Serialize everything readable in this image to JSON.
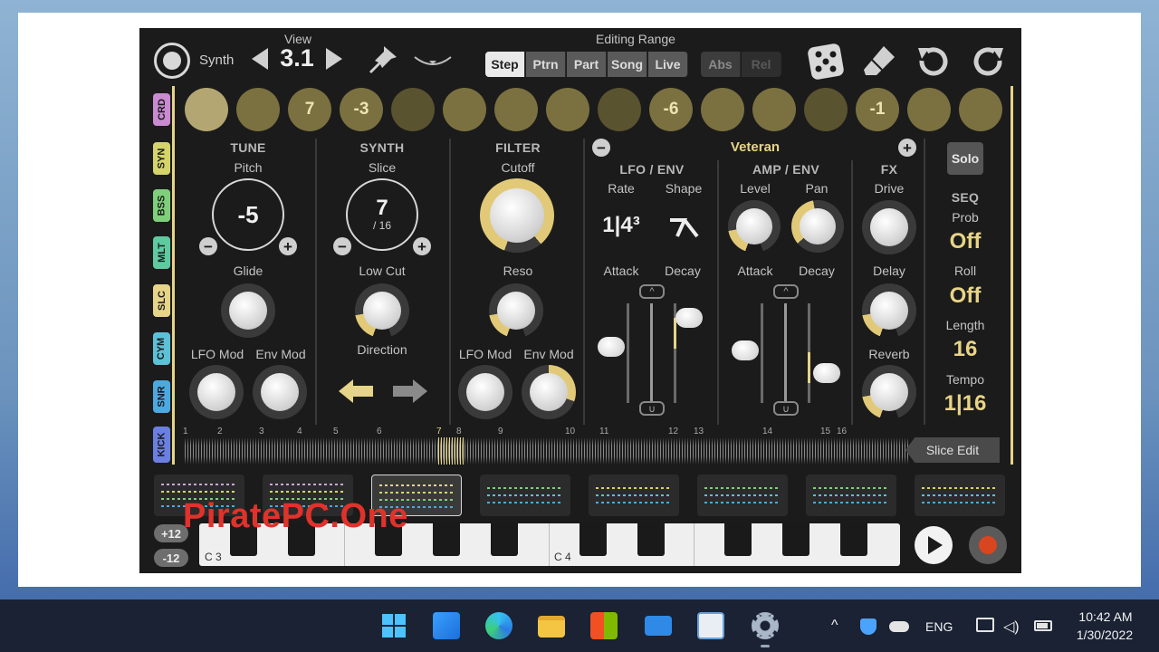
{
  "app": {
    "synth_label": "Synth",
    "view_label": "View",
    "view_value": "3.1",
    "editing_range_label": "Editing Range",
    "range_buttons": [
      "Step",
      "Ptrn",
      "Part",
      "Song",
      "Live"
    ],
    "mode_buttons": [
      "Abs",
      "Rel"
    ],
    "side_tabs": [
      {
        "label": "CRD",
        "color": "#c98ad2"
      },
      {
        "label": "SYN",
        "color": "#d4d46a"
      },
      {
        "label": "BSS",
        "color": "#7fcf7a"
      },
      {
        "label": "MLT",
        "color": "#5fc9a0"
      },
      {
        "label": "SLC",
        "color": "#e6d488"
      },
      {
        "label": "CYM",
        "color": "#5cc1d6"
      },
      {
        "label": "SNR",
        "color": "#4ca9e0"
      },
      {
        "label": "KICK",
        "color": "#6a7fe0"
      }
    ],
    "steps": [
      "",
      "",
      "7",
      "-3",
      "",
      "",
      "",
      "",
      "",
      "-6",
      "",
      "",
      "",
      "-1",
      "",
      ""
    ],
    "tune": {
      "header": "TUNE",
      "pitch_label": "Pitch",
      "pitch_value": "-5",
      "glide_label": "Glide",
      "lfo_mod_label": "LFO Mod",
      "env_mod_label": "Env Mod"
    },
    "synth": {
      "header": "SYNTH",
      "slice_label": "Slice",
      "slice_value": "7",
      "slice_total": "/ 16",
      "low_cut_label": "Low Cut",
      "direction_label": "Direction"
    },
    "filter": {
      "header": "FILTER",
      "cutoff_label": "Cutoff",
      "reso_label": "Reso",
      "lfo_mod_label": "LFO Mod",
      "env_mod_label": "Env Mod"
    },
    "preset_name": "Veteran",
    "lfo_env": {
      "header": "LFO / ENV",
      "rate_label": "Rate",
      "shape_label": "Shape",
      "rate_value": "1|4³",
      "attack_label": "Attack",
      "decay_label": "Decay"
    },
    "amp_env": {
      "header": "AMP / ENV",
      "level_label": "Level",
      "pan_label": "Pan",
      "attack_label": "Attack",
      "decay_label": "Decay"
    },
    "fx": {
      "header": "FX",
      "drive_label": "Drive",
      "delay_label": "Delay",
      "reverb_label": "Reverb"
    },
    "seq": {
      "solo_label": "Solo",
      "header": "SEQ",
      "prob_label": "Prob",
      "prob_value": "Off",
      "roll_label": "Roll",
      "roll_value": "Off",
      "length_label": "Length",
      "length_value": "16",
      "tempo_label": "Tempo",
      "tempo_value": "1|16"
    },
    "slice_markers": [
      "1",
      "2",
      "3",
      "4",
      "5",
      "6",
      "7",
      "8",
      "9",
      "10",
      "11",
      "12",
      "13",
      "14",
      "15",
      "16"
    ],
    "slice_edit_label": "Slice Edit",
    "octave_up": "+12",
    "octave_down": "-12",
    "key_c3": "C 3",
    "key_c4": "C 4"
  },
  "watermark": "PiratePC.One",
  "taskbar": {
    "lang": "ENG",
    "time": "10:42 AM",
    "date": "1/30/2022"
  }
}
